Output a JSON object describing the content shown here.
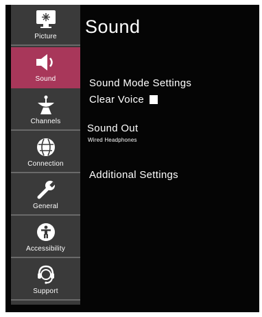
{
  "sidebar": {
    "items": [
      {
        "label": "Picture",
        "icon": "picture-icon",
        "active": false
      },
      {
        "label": "Sound",
        "icon": "speaker-icon",
        "active": true
      },
      {
        "label": "Channels",
        "icon": "satellite-dish-icon",
        "active": false
      },
      {
        "label": "Connection",
        "icon": "globe-network-icon",
        "active": false
      },
      {
        "label": "General",
        "icon": "wrench-icon",
        "active": false
      },
      {
        "label": "Accessibility",
        "icon": "accessibility-person-icon",
        "active": false
      },
      {
        "label": "Support",
        "icon": "headset-support-icon",
        "active": false
      }
    ]
  },
  "main": {
    "title": "Sound",
    "sound_mode_settings": "Sound Mode Settings",
    "clear_voice": "Clear Voice",
    "sound_out": "Sound Out",
    "sound_out_value": "Wired Headphones",
    "additional_settings": "Additional Settings"
  },
  "colors": {
    "active_highlight": "#a8375a",
    "sidebar_bg": "#3a3a3a",
    "screen_bg": "#050505",
    "text": "#ffffff"
  }
}
